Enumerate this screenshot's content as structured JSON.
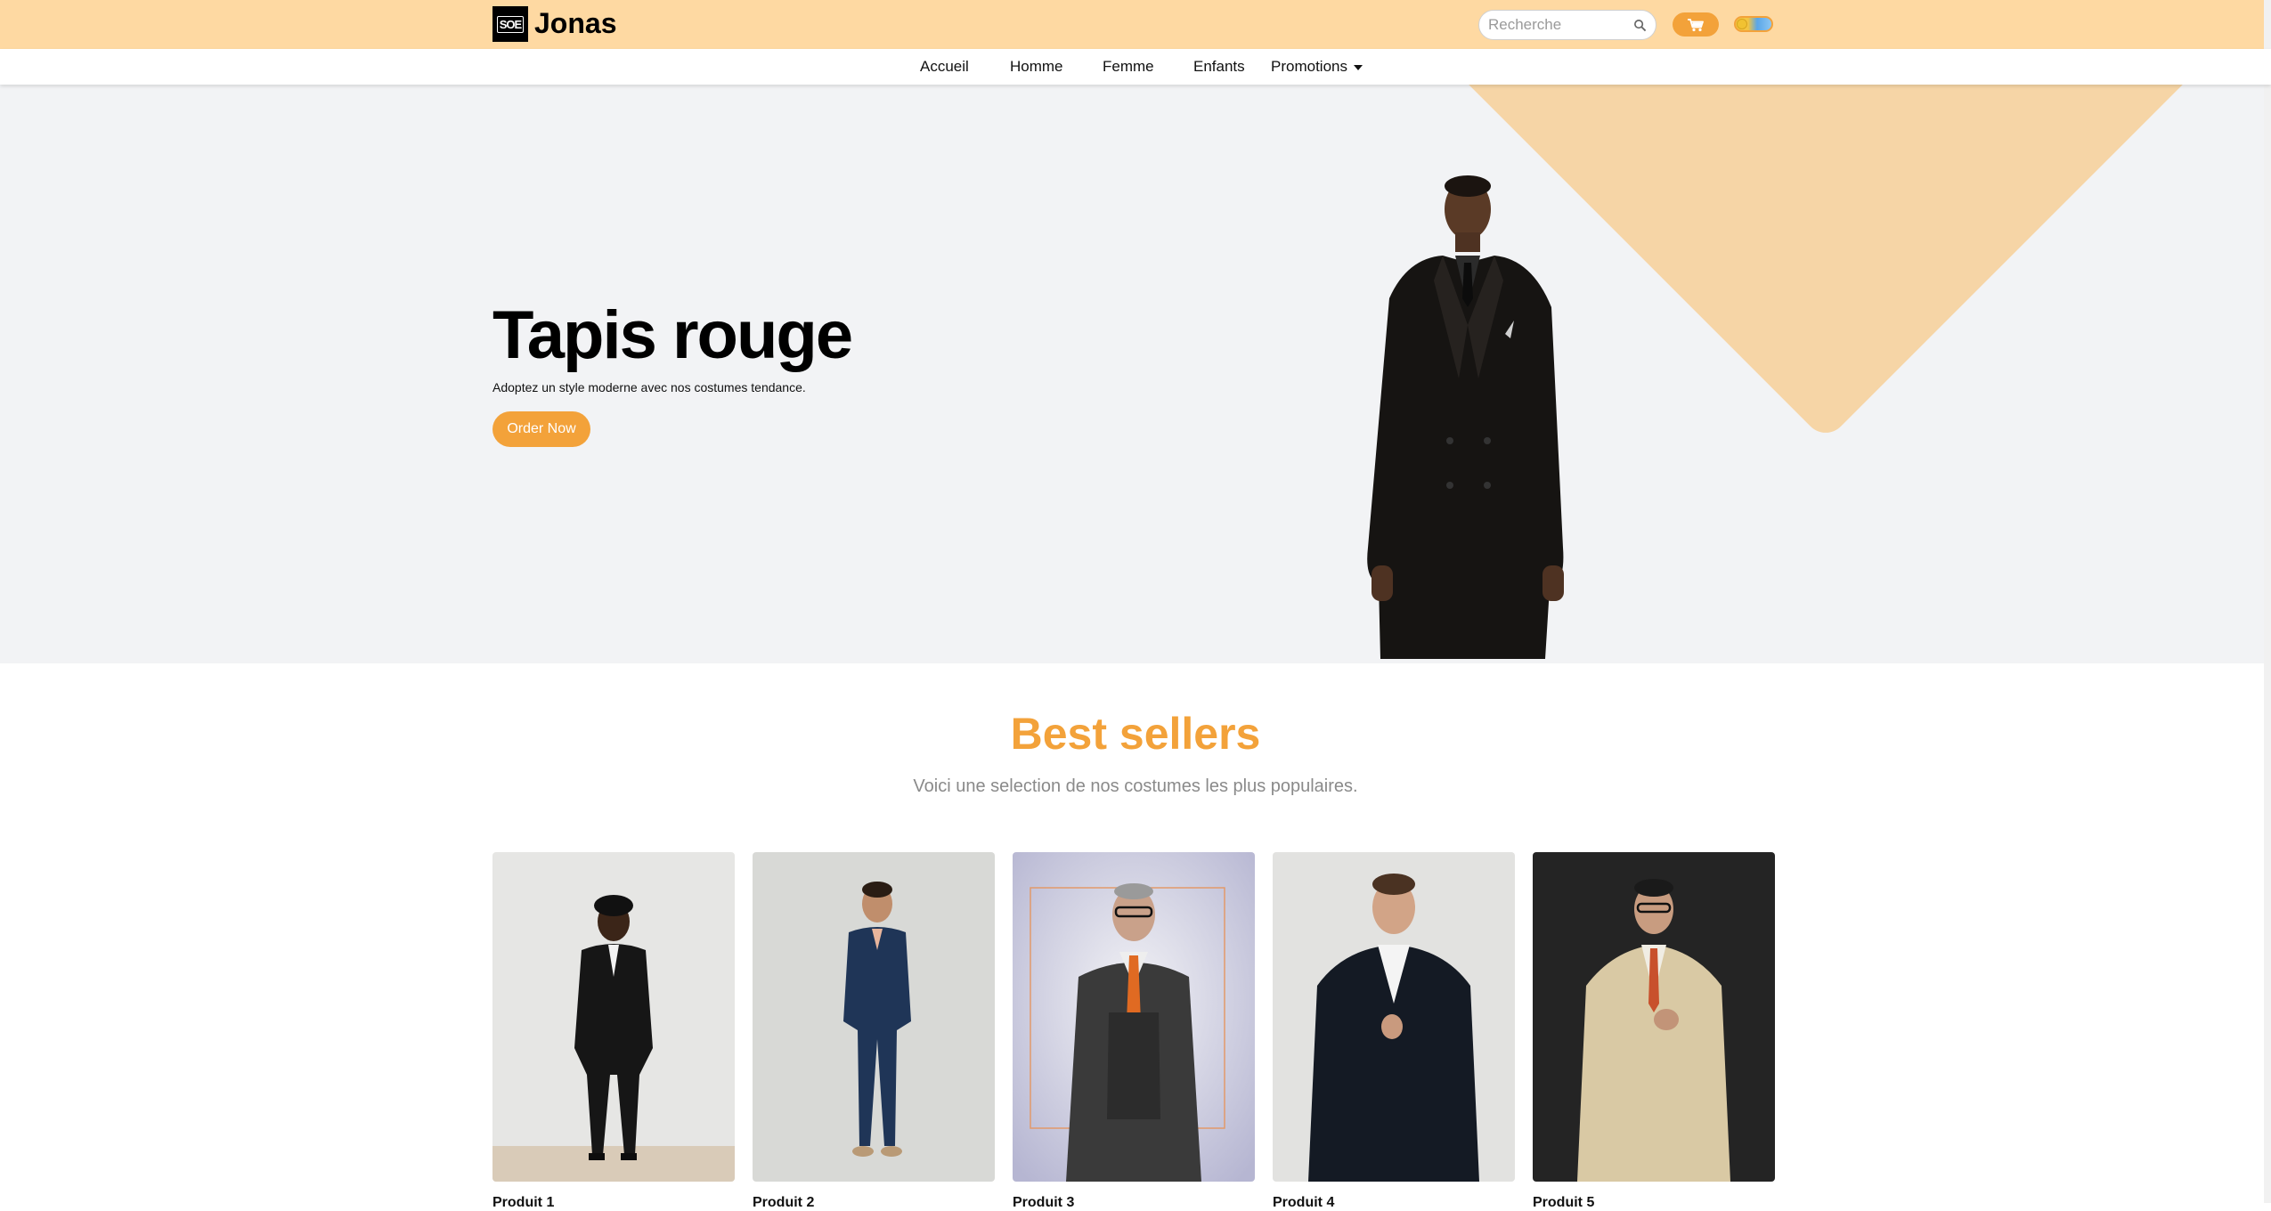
{
  "header": {
    "logo_text": "SOE",
    "brand": "Jonas",
    "search_placeholder": "Recherche",
    "colors": {
      "topbar": "#fed9a2",
      "accent": "#f3a23a"
    }
  },
  "nav": {
    "items": [
      {
        "label": "Accueil"
      },
      {
        "label": "Homme"
      },
      {
        "label": "Femme"
      },
      {
        "label": "Enfants"
      },
      {
        "label": "Promotions"
      }
    ]
  },
  "hero": {
    "title": "Tapis rouge",
    "subtitle": "Adoptez un style moderne avec nos costumes tendance.",
    "cta": "Order Now"
  },
  "best_sellers": {
    "title": "Best sellers",
    "subtitle": "Voici une selection de nos costumes les plus populaires.",
    "products": [
      {
        "name": "Produit 1"
      },
      {
        "name": "Produit 2"
      },
      {
        "name": "Produit 3"
      },
      {
        "name": "Produit 4"
      },
      {
        "name": "Produit 5"
      }
    ]
  }
}
